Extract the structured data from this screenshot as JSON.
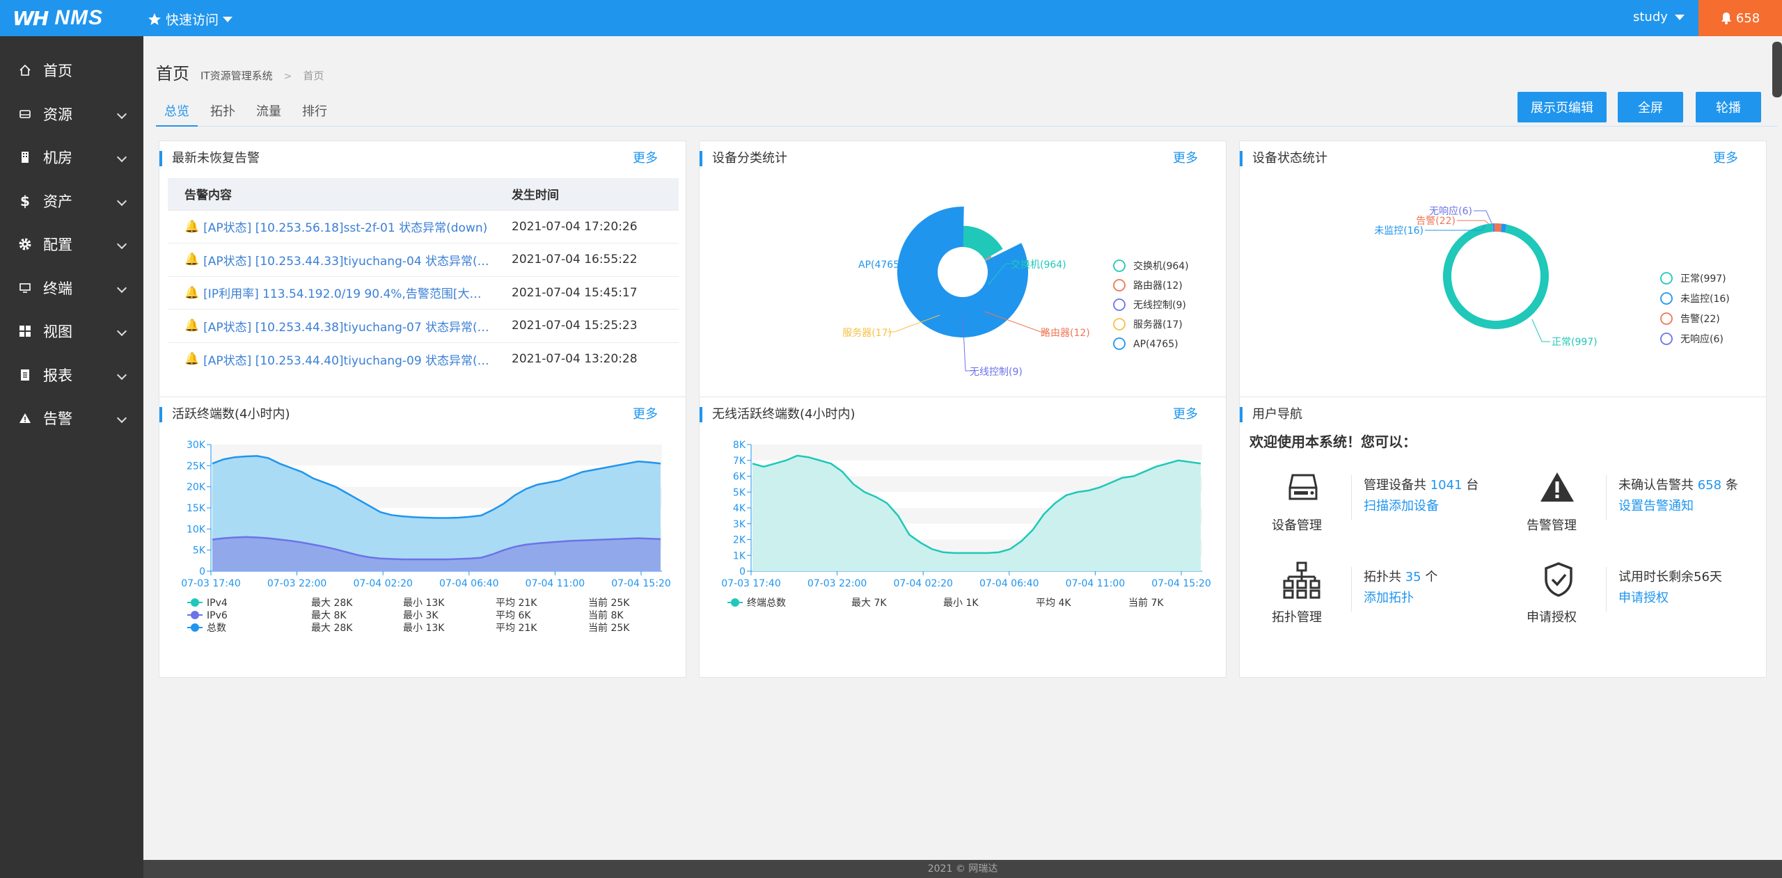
{
  "topbar": {
    "logo_mark": "WH",
    "app_name": "NMS",
    "quick_access": "快速访问",
    "user": "study",
    "alert_count": "658"
  },
  "sidebar": {
    "items": [
      {
        "label": "首页",
        "icon": "home-icon"
      },
      {
        "label": "资源",
        "icon": "storage-icon"
      },
      {
        "label": "机房",
        "icon": "building-icon"
      },
      {
        "label": "资产",
        "icon": "dollar-icon"
      },
      {
        "label": "配置",
        "icon": "gear-icon"
      },
      {
        "label": "终端",
        "icon": "monitor-icon"
      },
      {
        "label": "视图",
        "icon": "grid-icon"
      },
      {
        "label": "报表",
        "icon": "report-icon"
      },
      {
        "label": "告警",
        "icon": "warning-icon"
      }
    ]
  },
  "breadcrumb": {
    "title": "首页",
    "system": "IT资源管理系统",
    "sep": ">",
    "current": "首页"
  },
  "tabs": [
    "总览",
    "拓扑",
    "流量",
    "排行"
  ],
  "buttons": {
    "edit": "展示页编辑",
    "fullscreen": "全屏",
    "carousel": "轮播"
  },
  "panels": {
    "alarms": {
      "title": "最新未恢复告警",
      "more": "更多",
      "col_content": "告警内容",
      "col_time": "发生时间",
      "rows": [
        {
          "content": "[AP状态] [10.253.56.18]sst-2f-01 状态异常(down)",
          "time": "2021-07-04 17:20:26"
        },
        {
          "content": "[AP状态] [10.253.44.33]tiyuchang-04 状态异常(…",
          "time": "2021-07-04 16:55:22"
        },
        {
          "content": "[IP利用率] 113.54.192.0/19 90.4%,告警范围[大…",
          "time": "2021-07-04 15:45:17"
        },
        {
          "content": "[AP状态] [10.253.44.38]tiyuchang-07 状态异常(…",
          "time": "2021-07-04 15:25:23"
        },
        {
          "content": "[AP状态] [10.253.44.40]tiyuchang-09 状态异常(…",
          "time": "2021-07-04 13:20:28"
        }
      ]
    },
    "device_category": {
      "title": "设备分类统计",
      "more": "更多",
      "labels": [
        "AP(4765)",
        "交换机(964)",
        "路由器(12)",
        "无线控制(9)",
        "服务器(17)"
      ],
      "legend": [
        "交换机(964)",
        "路由器(12)",
        "无线控制(9)",
        "服务器(17)",
        "AP(4765)"
      ]
    },
    "device_status": {
      "title": "设备状态统计",
      "more": "更多",
      "labels": [
        "无响应(6)",
        "告警(22)",
        "未监控(16)",
        "正常(997)"
      ],
      "legend": [
        "正常(997)",
        "未监控(16)",
        "告警(22)",
        "无响应(6)"
      ]
    },
    "active_terminals": {
      "title": "活跃终端数(4小时内)",
      "more": "更多",
      "legend": [
        {
          "name": "IPv4",
          "max": "最大 28K",
          "min": "最小 13K",
          "avg": "平均 21K",
          "cur": "当前 25K"
        },
        {
          "name": "IPv6",
          "max": "最大 8K",
          "min": "最小 3K",
          "avg": "平均 6K",
          "cur": "当前 8K"
        },
        {
          "name": "总数",
          "max": "最大 28K",
          "min": "最小 13K",
          "avg": "平均 21K",
          "cur": "当前 25K"
        }
      ]
    },
    "wireless_terminals": {
      "title": "无线活跃终端数(4小时内)",
      "more": "更多",
      "legend": [
        {
          "name": "终端总数",
          "max": "最大 7K",
          "min": "最小 1K",
          "avg": "平均 4K",
          "cur": "当前 7K"
        }
      ]
    },
    "user_nav": {
      "title": "用户导航",
      "welcome": "欢迎使用本系统！您可以：",
      "cells": [
        {
          "label": "设备管理",
          "pre": "管理设备共",
          "num": "1041",
          "post": "台",
          "link": "扫描添加设备"
        },
        {
          "label": "告警管理",
          "pre": "未确认告警共",
          "num": "658",
          "post": "条",
          "link": "设置告警通知"
        },
        {
          "label": "拓扑管理",
          "pre": "拓扑共",
          "num": "35",
          "post": "个",
          "link": "添加拓扑"
        },
        {
          "label": "申请授权",
          "pre": "试用时长剩余56天",
          "num": "",
          "post": "",
          "link": "申请授权"
        }
      ]
    }
  },
  "chart_data": [
    {
      "type": "pie",
      "title": "设备分类统计",
      "categories": [
        "交换机",
        "路由器",
        "无线控制",
        "服务器",
        "AP"
      ],
      "values": [
        964,
        12,
        9,
        17,
        4765
      ],
      "colors": [
        "#1fc8b8",
        "#f07554",
        "#6b73e8",
        "#f6c045",
        "#1f95ee"
      ],
      "legend": "right"
    },
    {
      "type": "pie",
      "title": "设备状态统计",
      "categories": [
        "正常",
        "未监控",
        "告警",
        "无响应"
      ],
      "values": [
        997,
        16,
        22,
        6
      ],
      "colors": [
        "#1fc8b8",
        "#1f95ee",
        "#f07554",
        "#6b73e8"
      ],
      "legend": "right"
    },
    {
      "type": "area",
      "title": "活跃终端数(4小时内)",
      "x_ticks": [
        "07-03 17:40",
        "07-03 22:00",
        "07-04 02:20",
        "07-04 06:40",
        "07-04 11:00",
        "07-04 15:20"
      ],
      "y_ticks": [
        "0",
        "5K",
        "10K",
        "15K",
        "20K",
        "25K",
        "30K"
      ],
      "ylim": [
        0,
        30000
      ],
      "series": [
        {
          "name": "IPv4",
          "color": "#1fc8b8",
          "values": [
            25500,
            26500,
            27000,
            27200,
            27300,
            26800,
            25500,
            24500,
            23500,
            22000,
            21000,
            20000,
            18500,
            17000,
            15500,
            14000,
            13300,
            13000,
            12800,
            12700,
            12600,
            12600,
            12700,
            12900,
            13200,
            14500,
            16000,
            18000,
            19500,
            20500,
            21000,
            21500,
            22500,
            23500,
            24000,
            24500,
            25000,
            25500,
            26000,
            25800,
            25500
          ]
        },
        {
          "name": "IPv6",
          "color": "#6b73e8",
          "values": [
            7500,
            7800,
            8000,
            8100,
            8000,
            7800,
            7500,
            7200,
            6800,
            6300,
            5800,
            5200,
            4500,
            3800,
            3300,
            3000,
            2900,
            2800,
            2800,
            2800,
            2800,
            2800,
            2900,
            3000,
            3200,
            4000,
            5000,
            5800,
            6300,
            6600,
            6800,
            7000,
            7200,
            7300,
            7400,
            7500,
            7600,
            7700,
            7800,
            7700,
            7600
          ]
        },
        {
          "name": "总数",
          "color": "#1f95ee",
          "values": [
            25500,
            26500,
            27000,
            27200,
            27300,
            26800,
            25500,
            24500,
            23500,
            22000,
            21000,
            20000,
            18500,
            17000,
            15500,
            14000,
            13300,
            13000,
            12800,
            12700,
            12600,
            12600,
            12700,
            12900,
            13200,
            14500,
            16000,
            18000,
            19500,
            20500,
            21000,
            21500,
            22500,
            23500,
            24000,
            24500,
            25000,
            25500,
            26000,
            25800,
            25500
          ]
        }
      ]
    },
    {
      "type": "area",
      "title": "无线活跃终端数(4小时内)",
      "x_ticks": [
        "07-03 17:40",
        "07-03 22:00",
        "07-04 02:20",
        "07-04 06:40",
        "07-04 11:00",
        "07-04 15:20"
      ],
      "y_ticks": [
        "0",
        "1K",
        "2K",
        "3K",
        "4K",
        "5K",
        "6K",
        "7K",
        "8K"
      ],
      "ylim": [
        0,
        8000
      ],
      "series": [
        {
          "name": "终端总数",
          "color": "#1fc8b8",
          "values": [
            6800,
            6600,
            6800,
            7000,
            7300,
            7200,
            7000,
            6800,
            6300,
            5500,
            5000,
            4700,
            4300,
            3500,
            2300,
            1800,
            1400,
            1200,
            1150,
            1150,
            1150,
            1150,
            1200,
            1400,
            1900,
            2600,
            3600,
            4300,
            4800,
            5000,
            5100,
            5300,
            5600,
            5900,
            6000,
            6300,
            6600,
            6800,
            7000,
            6900,
            6800
          ]
        }
      ]
    }
  ]
}
